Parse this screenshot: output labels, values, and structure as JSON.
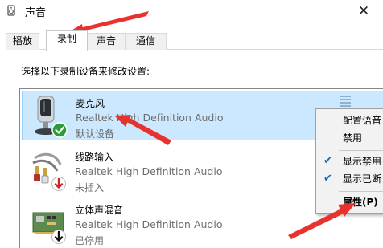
{
  "window": {
    "title": "声音",
    "close_glyph": "✕"
  },
  "tabs": [
    {
      "label": "播放",
      "active": false
    },
    {
      "label": "录制",
      "active": true
    },
    {
      "label": "声音",
      "active": false
    },
    {
      "label": "通信",
      "active": false
    }
  ],
  "instruction": "选择以下录制设备来修改设置:",
  "devices": [
    {
      "name": "麦克风",
      "driver": "Realtek High Definition Audio",
      "status": "默认设备",
      "icon": "microphone-icon",
      "badge": "default-check-badge",
      "selected": true
    },
    {
      "name": "线路输入",
      "driver": "Realtek High Definition Audio",
      "status": "未插入",
      "icon": "line-in-jack-icon",
      "badge": "unplugged-red-arrow-badge",
      "selected": false
    },
    {
      "name": "立体声混音",
      "driver": "Realtek High Definition Audio",
      "status": "已停用",
      "icon": "stereo-mix-board-icon",
      "badge": "disabled-black-arrow-badge",
      "selected": false
    }
  ],
  "context_menu": {
    "items": [
      {
        "label": "配置语音",
        "checked": false,
        "bold": false
      },
      {
        "label": "禁用",
        "checked": false,
        "bold": false
      },
      {
        "label": "显示禁用",
        "checked": true,
        "bold": false
      },
      {
        "label": "显示已断",
        "checked": true,
        "bold": false
      },
      {
        "label": "属性(P)",
        "checked": false,
        "bold": true
      }
    ],
    "check_glyph": "✔"
  },
  "colors": {
    "selection_bg": "#cce8ff",
    "selection_border": "#99d1ff",
    "annotation_red": "#e8322f",
    "check_green": "#2a9d3a",
    "menu_check_blue": "#1565c0"
  }
}
